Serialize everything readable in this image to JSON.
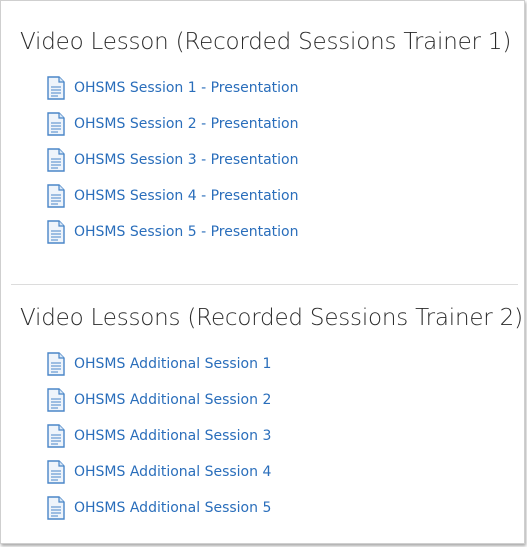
{
  "sections": [
    {
      "title": "Video Lesson (Recorded Sessions Trainer 1)",
      "items": [
        {
          "label": "OHSMS Session 1 - Presentation",
          "icon": "page-icon"
        },
        {
          "label": "OHSMS Session 2 - Presentation",
          "icon": "page-icon"
        },
        {
          "label": "OHSMS Session 3 - Presentation",
          "icon": "page-icon"
        },
        {
          "label": "OHSMS Session 4 - Presentation",
          "icon": "page-icon"
        },
        {
          "label": "OHSMS Session 5 - Presentation",
          "icon": "page-icon"
        }
      ]
    },
    {
      "title": "Video Lessons (Recorded Sessions Trainer 2)",
      "items": [
        {
          "label": "OHSMS Additional Session 1",
          "icon": "page-icon"
        },
        {
          "label": "OHSMS Additional Session 2",
          "icon": "page-icon"
        },
        {
          "label": "OHSMS Additional Session 3",
          "icon": "page-icon"
        },
        {
          "label": "OHSMS Additional Session 4",
          "icon": "page-icon"
        },
        {
          "label": "OHSMS Additional Session 5",
          "icon": "page-icon"
        }
      ]
    }
  ],
  "colors": {
    "link": "#2a6ebb",
    "title": "#2b2b2b",
    "icon": "#4a86c8"
  }
}
